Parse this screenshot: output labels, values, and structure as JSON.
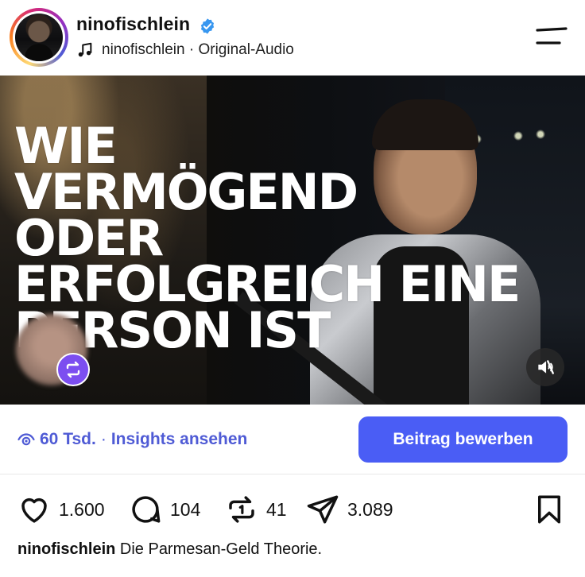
{
  "header": {
    "username": "ninofischlein",
    "verified": true,
    "audio_owner": "ninofischlein",
    "audio_separator": " · ",
    "audio_label": "Original-Audio",
    "icons": [
      "music-note-icon",
      "verified-badge-icon",
      "menu-icon"
    ]
  },
  "video": {
    "overlay_lines": [
      "WIE",
      "VERMÖGEND",
      "ODER",
      "ERFOLGREICH EINE",
      "PERSON IST"
    ],
    "muted": true,
    "icons": [
      "repost-icon",
      "muted-speaker-icon"
    ]
  },
  "insights": {
    "views": "60 Tsd.",
    "separator": "·",
    "link_label": "Insights ansehen",
    "promote_label": "Beitrag bewerben",
    "accent_color": "#4a5df5"
  },
  "actions": {
    "likes": "1.600",
    "comments": "104",
    "reposts": "41",
    "shares": "3.089",
    "icons": [
      "heart-icon",
      "comment-icon",
      "repost-icon",
      "share-icon",
      "bookmark-icon"
    ]
  },
  "caption": {
    "username": "ninofischlein",
    "text": "Die Parmesan-Geld Theorie."
  }
}
